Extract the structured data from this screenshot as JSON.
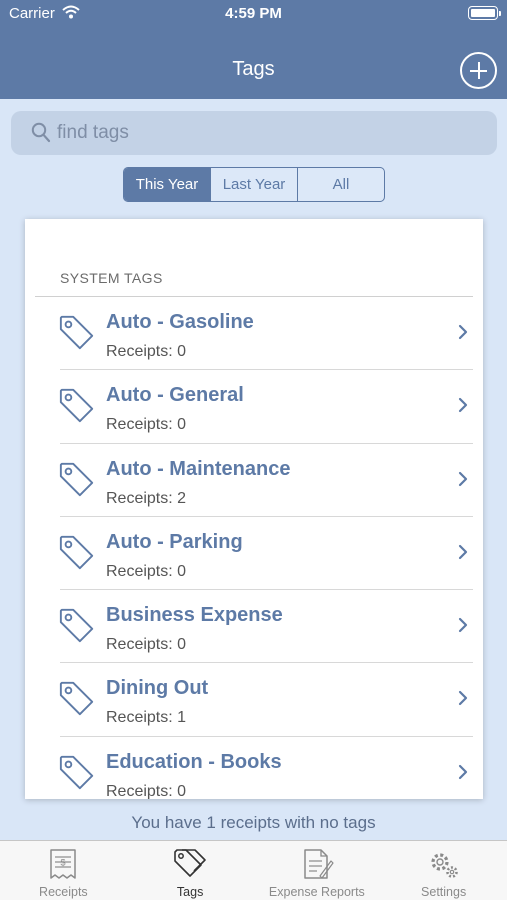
{
  "status_bar": {
    "carrier": "Carrier",
    "time": "4:59 PM"
  },
  "nav": {
    "title": "Tags",
    "add_icon": "plus-circle-icon"
  },
  "search": {
    "placeholder": "find tags",
    "value": ""
  },
  "filter": {
    "options": [
      "This Year",
      "Last Year",
      "All"
    ],
    "selected": "This Year"
  },
  "system_tags": {
    "header": "SYSTEM TAGS",
    "items": [
      {
        "name": "Auto - Gasoline",
        "receipts": "Receipts: 0"
      },
      {
        "name": "Auto - General",
        "receipts": "Receipts: 0"
      },
      {
        "name": "Auto - Maintenance",
        "receipts": "Receipts: 2"
      },
      {
        "name": "Auto - Parking",
        "receipts": "Receipts: 0"
      },
      {
        "name": "Business Expense",
        "receipts": "Receipts: 0"
      },
      {
        "name": "Dining Out",
        "receipts": "Receipts: 1"
      },
      {
        "name": "Education - Books",
        "receipts": "Receipts: 0"
      }
    ]
  },
  "footer_note": "You have 1 receipts with no tags",
  "tabs": [
    {
      "label": "Receipts",
      "icon": "receipt-icon",
      "active": false
    },
    {
      "label": "Tags",
      "icon": "tags-icon",
      "active": true
    },
    {
      "label": "Expense Reports",
      "icon": "expense-report-icon",
      "active": false
    },
    {
      "label": "Settings",
      "icon": "gear-icon",
      "active": false
    }
  ],
  "colors": {
    "accent": "#5d7aa6",
    "background": "#d9e6f7",
    "search_field": "#c3d2e6"
  }
}
